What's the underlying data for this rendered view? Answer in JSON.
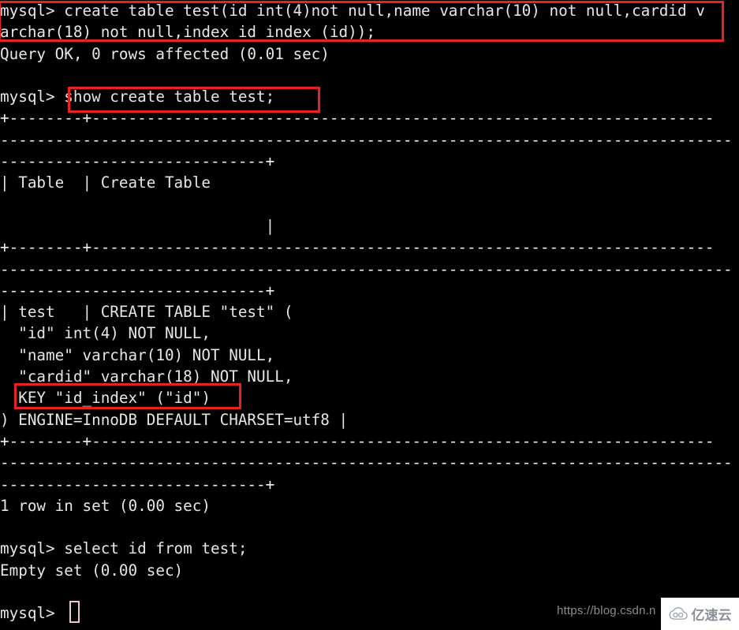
{
  "terminal": {
    "app": "mysql-client-terminal",
    "background_color": "#000000",
    "text_color": "#e6e6e6",
    "lines": [
      "mysql> create table test(id int(4)not null,name varchar(10) not null,cardid v",
      "archar(18) not null,index id_index (id));",
      "Query OK, 0 rows affected (0.01 sec)",
      "",
      "mysql> show create table test;",
      "+--------+--------------------------------------------------------------------",
      "--------------------------------------------------------------------------------",
      "-----------------------------+",
      "| Table  | Create Table",
      "",
      "                             |",
      "+--------+--------------------------------------------------------------------",
      "--------------------------------------------------------------------------------",
      "-----------------------------+",
      "| test   | CREATE TABLE \"test\" (",
      "  \"id\" int(4) NOT NULL,",
      "  \"name\" varchar(10) NOT NULL,",
      "  \"cardid\" varchar(18) NOT NULL,",
      "  KEY \"id_index\" (\"id\")",
      ") ENGINE=InnoDB DEFAULT CHARSET=utf8 |",
      "+--------+--------------------------------------------------------------------",
      "--------------------------------------------------------------------------------",
      "-----------------------------+",
      "1 row in set (0.00 sec)",
      "",
      "mysql> select id from test;",
      "Empty set (0.00 sec)",
      "",
      "mysql> "
    ],
    "prompt": "mysql>",
    "cursor": {
      "name": "text-cursor",
      "style": "hollow-block",
      "color": "#e9c9cf"
    }
  },
  "commands": {
    "create_table": "create table test(id int(4)not null,name varchar(10) not null,cardid varchar(18) not null,index id_index (id));",
    "create_table_result": "Query OK, 0 rows affected (0.01 sec)",
    "show_create_table": "show create table test;",
    "show_create_table_result": "1 row in set (0.00 sec)",
    "select_id": "select id from test;",
    "select_id_result": "Empty set (0.00 sec)"
  },
  "result_table": {
    "columns": [
      "Table",
      "Create Table"
    ],
    "row": {
      "table": "test",
      "create_table": [
        "CREATE TABLE \"test\" (",
        "  \"id\" int(4) NOT NULL,",
        "  \"name\" varchar(10) NOT NULL,",
        "  \"cardid\" varchar(18) NOT NULL,",
        "  KEY \"id_index\" (\"id\")",
        ") ENGINE=InnoDB DEFAULT CHARSET=utf8"
      ]
    }
  },
  "annotations": {
    "color": "#e8221f",
    "boxes": [
      {
        "id": "create-statement",
        "label": "create table test(id int(4)not null,name varchar(10) not null,cardid varchar(18) not null,index id_index (id));"
      },
      {
        "id": "show-create-statement",
        "label": "show create table test;"
      },
      {
        "id": "key-index-line",
        "label": "KEY \"id_index\" (\"id\")"
      }
    ]
  },
  "watermarks": {
    "csdn": "https://blog.csdn.n",
    "brand": "亿速云",
    "brand_icon": "cloud-icon"
  }
}
